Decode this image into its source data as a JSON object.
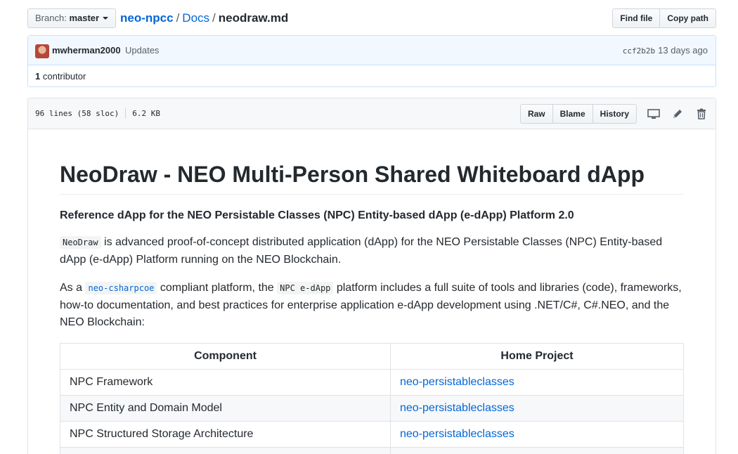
{
  "branch": {
    "label": "Branch:",
    "value": "master"
  },
  "breadcrumb": {
    "repo": "neo-npcc",
    "sep1": "/",
    "folder": "Docs",
    "sep2": "/",
    "file": "neodraw.md"
  },
  "toolbar": {
    "find_file": "Find file",
    "copy_path": "Copy path"
  },
  "commit": {
    "author": "mwherman2000",
    "message": "Updates",
    "sha": "ccf2b2b",
    "time": "13 days ago"
  },
  "contributors": {
    "count": "1",
    "label": "contributor"
  },
  "file": {
    "lines": "96 lines (58 sloc)",
    "size": "6.2 KB",
    "raw": "Raw",
    "blame": "Blame",
    "history": "History",
    "icons": [
      "desktop-icon",
      "pencil-icon",
      "trash-icon"
    ]
  },
  "content": {
    "title": "NeoDraw - NEO Multi-Person Shared Whiteboard dApp",
    "subtitle": "Reference dApp for the NEO Persistable Classes (NPC) Entity-based dApp (e-dApp) Platform 2.0",
    "p1_code": "NeoDraw",
    "p1_text": " is advanced proof-of-concept distributed application (dApp) for the NEO Persistable Classes (NPC) Entity-based dApp (e-dApp) Platform running on the NEO Blockchain.",
    "p2_a": "As a ",
    "p2_link": "neo-csharpcoe",
    "p2_b": " compliant platform, the ",
    "p2_code": "NPC e-dApp",
    "p2_c": " platform includes a full suite of tools and libraries (code), frameworks, how-to documentation, and best practices for enterprise application e-dApp development using .NET/C#, C#.NEO, and the NEO Blockchain:"
  },
  "table": {
    "headers": [
      "Component",
      "Home Project"
    ],
    "rows": [
      [
        "NPC Framework",
        "neo-persistableclasses"
      ],
      [
        "NPC Entity and Domain Model",
        "neo-persistableclasses"
      ],
      [
        "NPC Structured Storage Architecture",
        "neo-persistableclasses"
      ]
    ]
  },
  "colors": {
    "link": "#0366d6",
    "commit_bg": "#f1f8ff",
    "commit_border": "#c8e1ff"
  }
}
